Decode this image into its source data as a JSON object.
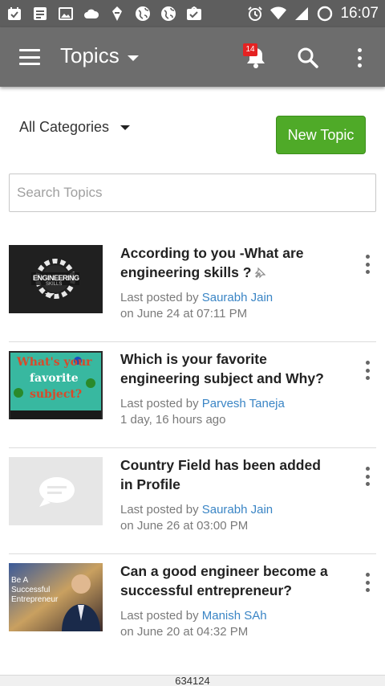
{
  "status_bar": {
    "time": "16:07",
    "icons": [
      "calendar-icon",
      "message-icon",
      "gallery-icon",
      "weather-icon",
      "pen-icon",
      "globe-icon",
      "globe-icon",
      "chat-icon",
      "alarm-icon",
      "wifi-icon",
      "signal-icon",
      "battery-icon"
    ]
  },
  "app_bar": {
    "title": "Topics",
    "notification_count": "14",
    "icons": [
      "menu-icon",
      "chevron-down-icon",
      "bell-icon",
      "search-icon",
      "more-vertical-icon"
    ]
  },
  "filters": {
    "category_label": "All Categories",
    "new_topic_label": "New Topic"
  },
  "search": {
    "placeholder": "Search Topics",
    "value": ""
  },
  "topics": [
    {
      "title": "According to you -What are engineering skills ?",
      "pinned": true,
      "meta_prefix": "Last posted by ",
      "author": "Saurabh Jain",
      "time": "on June 24 at 07:11 PM",
      "thumb_text_lines": [
        "ENGINEERING",
        "SKILLS"
      ]
    },
    {
      "title": "Which is your favorite engineering subject and Why?",
      "pinned": false,
      "meta_prefix": "Last posted by ",
      "author": "Parvesh Taneja",
      "time": "1 day, 16 hours ago",
      "thumb_text_lines": [
        "What's your",
        "favorite",
        "subject?"
      ]
    },
    {
      "title": "Country Field has been added in Profile",
      "pinned": false,
      "meta_prefix": "Last posted by ",
      "author": "Saurabh Jain",
      "time": "on June 26 at 03:00 PM",
      "thumb_text_lines": []
    },
    {
      "title": "Can a good engineer become a successful entrepreneur?",
      "pinned": false,
      "meta_prefix": "Last posted by ",
      "author": "Manish SAh",
      "time": "on June 20 at 04:32 PM",
      "thumb_text_lines": [
        "Be A",
        "Successful",
        "Entrepreneur"
      ]
    }
  ],
  "footer": {
    "text": "634124"
  },
  "colors": {
    "status_bar": "#5e5e5e",
    "app_bar": "#6d6d6d",
    "accent_green": "#4faa28",
    "link_blue": "#3a85c5",
    "badge_red": "#e52222"
  }
}
